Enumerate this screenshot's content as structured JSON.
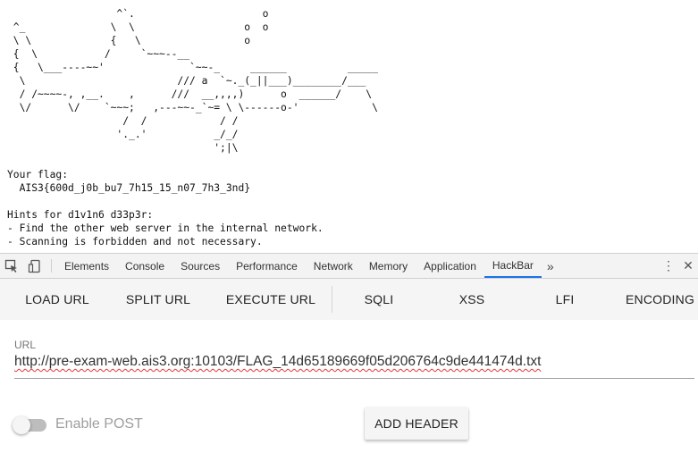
{
  "page": {
    "ascii_art": "                  ^`.                     o\n ^_              \\  \\                  o  o\n \\ \\             {   \\                 o\n {  \\           /     `~~~--__\n {   \\___----~~'              `~~-_     ______          _____\n  \\                         /// a  `~._(_||___)________/___\n  / /~~~~-, ,__.    ,      ///  __,,,,)      o  ______/    \\\n  \\/      \\/    `~~~;   ,---~~-_`~= \\ \\------o-'            \\\n                   /  /            / /\n                  '._.'           _/_/\n                                  ';|\\",
    "flag_label": "Your flag:",
    "flag_value": "  AIS3{600d_j0b_bu7_7h15_15_n07_7h3_3nd}",
    "hints_title": "Hints for d1v1n6 d33p3r:",
    "hint_1": "- Find the other web server in the internal network.",
    "hint_2": "- Scanning is forbidden and not necessary."
  },
  "devtools": {
    "tabs": [
      "Elements",
      "Console",
      "Sources",
      "Performance",
      "Network",
      "Memory",
      "Application",
      "HackBar"
    ],
    "active_tab": "HackBar",
    "more_icon": "double-chevron-right-icon",
    "icons": [
      "inspect-element-icon",
      "device-toolbar-icon",
      "kebab-menu-icon",
      "close-icon"
    ]
  },
  "hackbar": {
    "buttons": {
      "load_url": "LOAD URL",
      "split_url": "SPLIT URL",
      "execute_url": "EXECUTE URL",
      "sqli": "SQLI",
      "xss": "XSS",
      "lfi": "LFI",
      "encoding": "ENCODING"
    },
    "url_label": "URL",
    "url_value": "http://pre-exam-web.ais3.org:10103/FLAG_14d65189669f05d206764c9de441474d.txt",
    "enable_post_label": "Enable POST",
    "enable_post": false,
    "add_header_label": "ADD HEADER"
  },
  "colors": {
    "active_tab_underline": "#1a73e8",
    "spellcheck_underline": "#e53935"
  }
}
